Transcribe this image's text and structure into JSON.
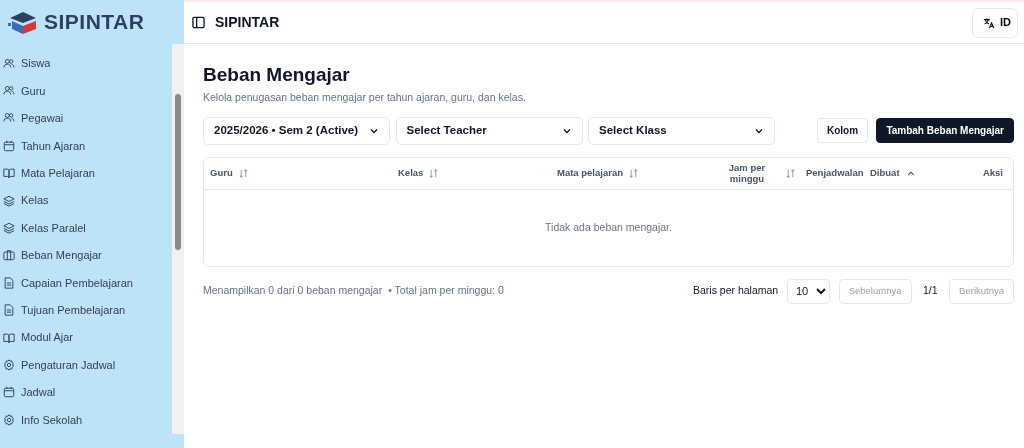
{
  "sidebar": {
    "brand": "SIPINTAR",
    "items": [
      {
        "label": "Siswa",
        "kind": "people"
      },
      {
        "label": "Guru",
        "kind": "people"
      },
      {
        "label": "Pegawai",
        "kind": "people"
      },
      {
        "label": "Tahun Ajaran",
        "kind": "calendar"
      },
      {
        "label": "Mata Pelajaran",
        "kind": "book"
      },
      {
        "label": "Kelas",
        "kind": "layers"
      },
      {
        "label": "Kelas Paralel",
        "kind": "layers"
      },
      {
        "label": "Beban Mengajar",
        "kind": "briefcase"
      },
      {
        "label": "Capaian Pembelajaran",
        "kind": "file"
      },
      {
        "label": "Tujuan Pembelajaran",
        "kind": "file"
      },
      {
        "label": "Modul Ajar",
        "kind": "book"
      },
      {
        "label": "Pengaturan Jadwal",
        "kind": "gear"
      },
      {
        "label": "Jadwal",
        "kind": "calendar"
      },
      {
        "label": "Info Sekolah",
        "kind": "gear"
      }
    ]
  },
  "header": {
    "title": "SIPINTAR",
    "language": "ID"
  },
  "page": {
    "title": "Beban Mengajar",
    "subtitle": "Kelola penugasan beban mengajar per tahun ajaran, guru, dan kelas."
  },
  "filters": [
    {
      "value": "2025/2026 • Sem 2 (Active)"
    },
    {
      "value": "Select Teacher"
    },
    {
      "value": "Select Klass"
    }
  ],
  "buttons": [
    {
      "label": "Kolom",
      "kind": "outline"
    },
    {
      "label": "Tambah Beban Mengajar",
      "kind": "primary"
    }
  ],
  "table": {
    "columns": [
      {
        "label": "Guru",
        "kind": "sortable"
      },
      {
        "label": "Kelas",
        "kind": "sortable"
      },
      {
        "label": "Mata pelajaran",
        "kind": "sortable"
      },
      {
        "label": "Jam per minggu",
        "kind": "sortable"
      },
      {
        "label": "Penjadwalan",
        "kind": "plain"
      },
      {
        "label": "Dibuat",
        "kind": "ascending"
      },
      {
        "label": "Aksi",
        "kind": "plain"
      }
    ],
    "empty": "Tidak ada beban mengajar."
  },
  "footer": {
    "summary": "Menampilkan 0 dari 0 beban mengajar",
    "total": "• Total jam per minggu: 0",
    "rows_label": "Baris per halaman",
    "rows_value": "10",
    "prev": "Sebelumnya",
    "page": "1/1",
    "next": "Berikutnya"
  }
}
